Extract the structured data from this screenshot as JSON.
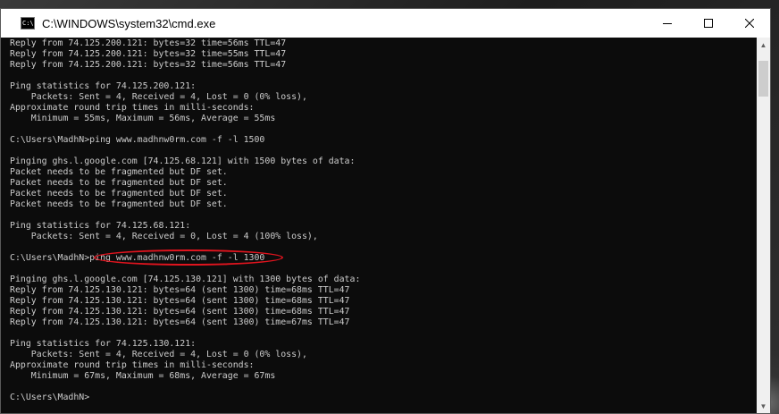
{
  "window": {
    "title": "C:\\WINDOWS\\system32\\cmd.exe",
    "icon_text": "C:\\"
  },
  "console": {
    "lines": [
      "Reply from 74.125.200.121: bytes=32 time=56ms TTL=47",
      "Reply from 74.125.200.121: bytes=32 time=55ms TTL=47",
      "Reply from 74.125.200.121: bytes=32 time=56ms TTL=47",
      "",
      "Ping statistics for 74.125.200.121:",
      "    Packets: Sent = 4, Received = 4, Lost = 0 (0% loss),",
      "Approximate round trip times in milli-seconds:",
      "    Minimum = 55ms, Maximum = 56ms, Average = 55ms",
      "",
      "C:\\Users\\MadhN>ping www.madhnw0rm.com -f -l 1500",
      "",
      "Pinging ghs.l.google.com [74.125.68.121] with 1500 bytes of data:",
      "Packet needs to be fragmented but DF set.",
      "Packet needs to be fragmented but DF set.",
      "Packet needs to be fragmented but DF set.",
      "Packet needs to be fragmented but DF set.",
      "",
      "Ping statistics for 74.125.68.121:",
      "    Packets: Sent = 4, Received = 0, Lost = 4 (100% loss),",
      "",
      "C:\\Users\\MadhN>ping www.madhnw0rm.com -f -l 1300",
      "",
      "Pinging ghs.l.google.com [74.125.130.121] with 1300 bytes of data:",
      "Reply from 74.125.130.121: bytes=64 (sent 1300) time=68ms TTL=47",
      "Reply from 74.125.130.121: bytes=64 (sent 1300) time=68ms TTL=47",
      "Reply from 74.125.130.121: bytes=64 (sent 1300) time=68ms TTL=47",
      "Reply from 74.125.130.121: bytes=64 (sent 1300) time=67ms TTL=47",
      "",
      "Ping statistics for 74.125.130.121:",
      "    Packets: Sent = 4, Received = 4, Lost = 0 (0% loss),",
      "Approximate round trip times in milli-seconds:",
      "    Minimum = 67ms, Maximum = 68ms, Average = 67ms",
      "",
      "C:\\Users\\MadhN>"
    ],
    "text_color": "#cccccc",
    "background": "#0c0c0c",
    "annotation_color": "#e0141e"
  }
}
